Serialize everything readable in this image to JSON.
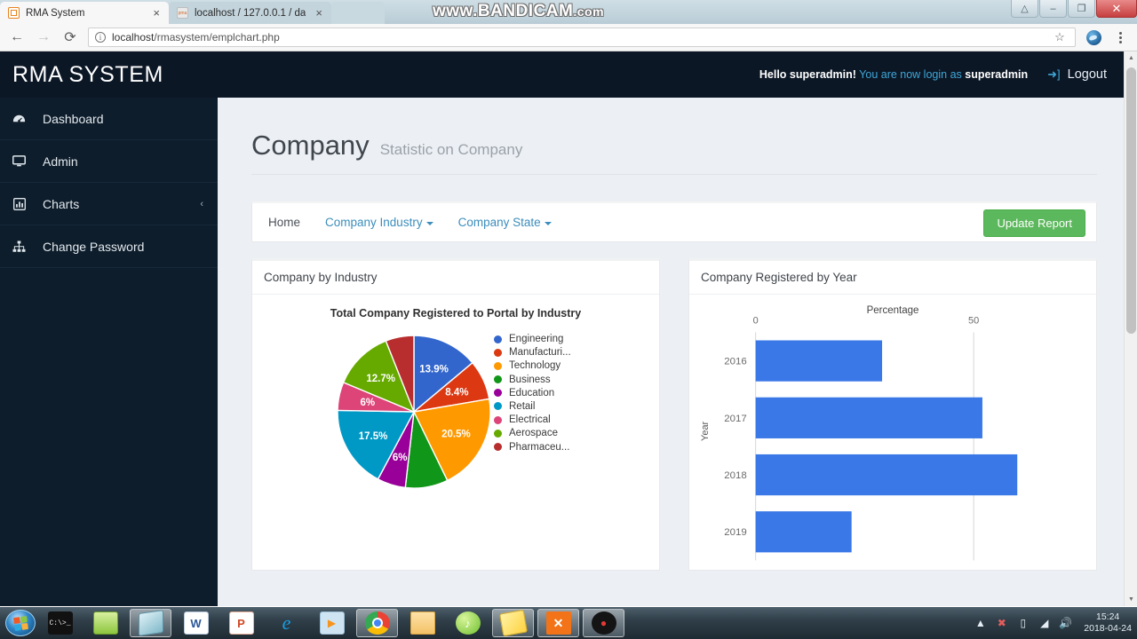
{
  "browser": {
    "tabs": [
      {
        "title": "RMA System",
        "favicon": "rma-icon",
        "active": true,
        "close_label": "×"
      },
      {
        "title": "localhost / 127.0.0.1 / da",
        "favicon": "phpmyadmin-icon",
        "active": false,
        "close_label": "×"
      }
    ],
    "window_controls": {
      "user_label": "△",
      "minimize_label": "–",
      "maximize_label": "❐",
      "close_label": "✕"
    },
    "watermark": {
      "main": "www.BANDICAM",
      "suffix": ".com"
    },
    "nav": {
      "back": "←",
      "forward": "→",
      "reload": "⟳"
    },
    "omnibox": {
      "info_glyph": "i",
      "url_host": "localhost",
      "url_path": "/rmasystem/emplchart.php",
      "star_icon": "☆"
    }
  },
  "app": {
    "brand": "RMA SYSTEM",
    "header": {
      "greeting": "Hello superadmin!",
      "login_notice": "You are now login as",
      "username": "superadmin",
      "logout_label": "Logout"
    },
    "sidebar": {
      "items": [
        {
          "label": "Dashboard",
          "icon": "dashboard-icon",
          "glyph": "⛁",
          "caret": ""
        },
        {
          "label": "Admin",
          "icon": "monitor-icon",
          "glyph": "Ὓ5",
          "caret": ""
        },
        {
          "label": "Charts",
          "icon": "bar-chart-icon",
          "glyph": "Ὄa",
          "caret": "‹"
        },
        {
          "label": "Change Password",
          "icon": "sitemap-icon",
          "glyph": "὜2",
          "caret": ""
        }
      ]
    },
    "page": {
      "title": "Company",
      "subtitle": "Statistic on Company"
    },
    "navbar": {
      "links": [
        {
          "label": "Home",
          "dropdown": false
        },
        {
          "label": "Company Industry",
          "dropdown": true
        },
        {
          "label": "Company State",
          "dropdown": true
        }
      ],
      "update_button": "Update Report"
    },
    "cards": [
      {
        "title": "Company by Industry"
      },
      {
        "title": "Company Registered by Year"
      }
    ]
  },
  "chart_data": [
    {
      "type": "pie",
      "title": "Total Company Registered to Portal by Industry",
      "legend_position": "right",
      "categories": [
        "Engineering",
        "Manufacturi...",
        "Technology",
        "Business",
        "Education",
        "Retail",
        "Electrical",
        "Aerospace",
        "Pharmaceu..."
      ],
      "values": [
        13.9,
        8.4,
        20.5,
        9.0,
        6.0,
        17.5,
        6.0,
        12.7,
        6.0
      ],
      "value_labels": [
        "13.9%",
        "8.4%",
        "20.5%",
        "",
        "6%",
        "17.5%",
        "6%",
        "12.7%",
        ""
      ],
      "colors": [
        "#3366cc",
        "#dc3912",
        "#ff9900",
        "#109618",
        "#990099",
        "#0099c6",
        "#dd4477",
        "#66aa00",
        "#b82e2e"
      ],
      "unit": "%"
    },
    {
      "type": "bar",
      "orientation": "horizontal",
      "title": "Percentage",
      "xlabel": "Percentage",
      "ylabel": "Year",
      "categories": [
        "2016",
        "2017",
        "2018",
        "2019"
      ],
      "values": [
        29,
        52,
        60,
        22
      ],
      "xticks": [
        "0",
        "50"
      ],
      "xtick_values": [
        0,
        50
      ],
      "xlim": [
        0,
        72
      ],
      "bar_color": "#3b78e7",
      "grid": true
    }
  ],
  "taskbar": {
    "start_label": "Start",
    "items": [
      {
        "name": "command-prompt",
        "label": "C:\\>_"
      },
      {
        "name": "notepad-plus-plus",
        "label": ""
      },
      {
        "name": "sublime-text",
        "label": ""
      },
      {
        "name": "microsoft-word",
        "label": "W"
      },
      {
        "name": "microsoft-powerpoint",
        "label": "P"
      },
      {
        "name": "internet-explorer",
        "label": "e"
      },
      {
        "name": "media-player",
        "label": "▶"
      },
      {
        "name": "google-chrome",
        "label": ""
      },
      {
        "name": "file-explorer",
        "label": ""
      },
      {
        "name": "music-app",
        "label": "♪"
      },
      {
        "name": "sticky-notes",
        "label": ""
      },
      {
        "name": "xampp",
        "label": "✕"
      },
      {
        "name": "bandicam",
        "label": "●"
      }
    ],
    "tray": {
      "show_hidden": "▲",
      "antivirus": "✖",
      "battery": "▯",
      "network": "◢",
      "volume": "ὐa",
      "time": "15:24",
      "date": "2018-04-24"
    }
  }
}
